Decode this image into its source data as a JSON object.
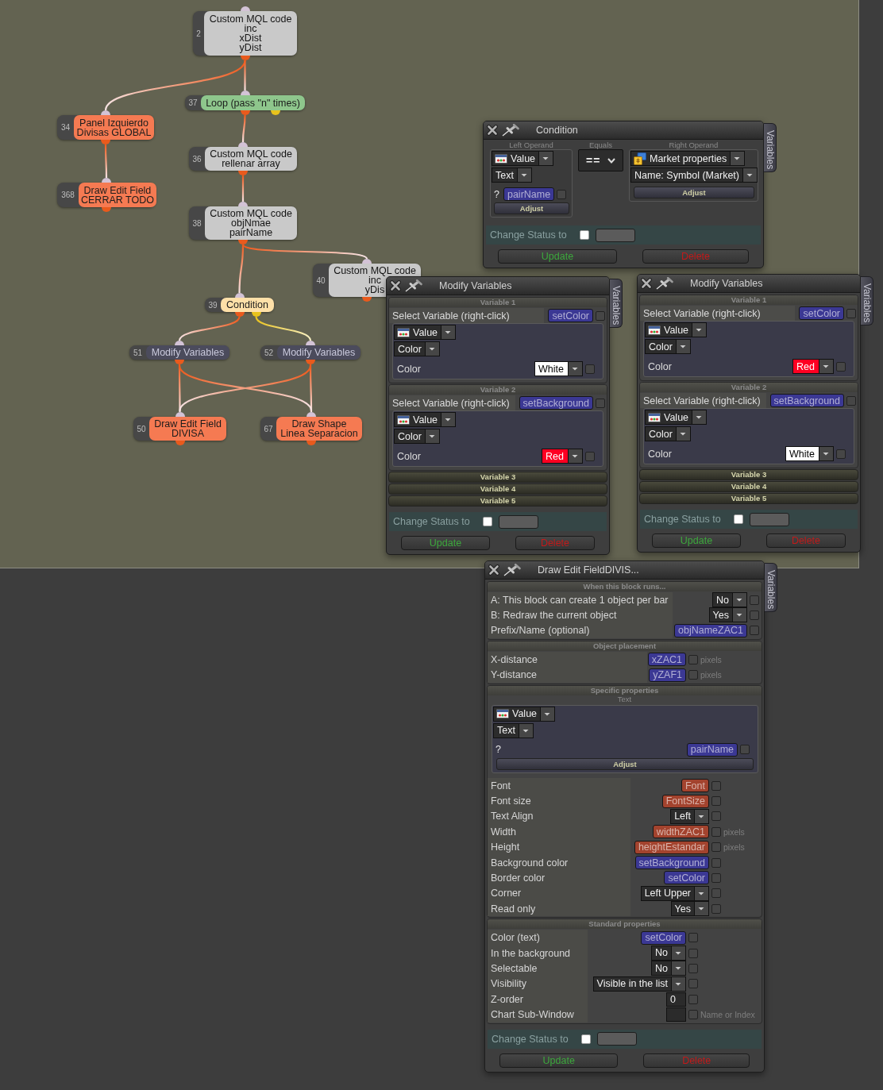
{
  "canvas": {
    "nodes": [
      {
        "number": "2",
        "kind": "code",
        "lines": [
          "Custom MQL code",
          "inc",
          "xDist",
          "yDist"
        ]
      },
      {
        "number": "37",
        "kind": "loop",
        "lines": [
          "Loop (pass \"n\" times)"
        ]
      },
      {
        "number": "34",
        "kind": "object",
        "lines": [
          "Panel Izquierdo",
          "Divisas GLOBAL"
        ]
      },
      {
        "number": "36",
        "kind": "code",
        "lines": [
          "Custom MQL code",
          "rellenar array"
        ]
      },
      {
        "number": "368",
        "kind": "object",
        "lines": [
          "Draw Edit Field",
          "CERRAR TODO"
        ]
      },
      {
        "number": "38",
        "kind": "code",
        "lines": [
          "Custom MQL code",
          "objNmae",
          "pairName"
        ]
      },
      {
        "number": "40",
        "kind": "code",
        "lines": [
          "Custom MQL code",
          "inc",
          "yDis"
        ]
      },
      {
        "number": "39",
        "kind": "condition",
        "lines": [
          "Condition"
        ]
      },
      {
        "number": "51",
        "kind": "modify",
        "lines": [
          "Modify Variables"
        ]
      },
      {
        "number": "52",
        "kind": "modify",
        "lines": [
          "Modify Variables"
        ]
      },
      {
        "number": "50",
        "kind": "object",
        "lines": [
          "Draw Edit Field",
          "DIVISA"
        ]
      },
      {
        "number": "67",
        "kind": "object",
        "lines": [
          "Draw Shape",
          "Linea Separacion"
        ]
      }
    ]
  },
  "windows": [
    {
      "kind": "condition",
      "title": "Condition",
      "side_tab": "Variables",
      "left_operand": {
        "heading": "Left Operand",
        "source": {
          "kind": "value",
          "label": "Value"
        },
        "type": "Text",
        "prefix": "?",
        "variable": {
          "label": "pairName",
          "color": "#3b3894"
        },
        "checked": false,
        "adjust": "Adjust"
      },
      "operator": {
        "heading": "Equals",
        "label": "=="
      },
      "right_operand": {
        "heading": "Right Operand",
        "source": {
          "kind": "market",
          "label": "Market properties"
        },
        "type": "Name: Symbol (Market)",
        "adjust": "Adjust"
      },
      "status": {
        "label": "Change Status to",
        "checked": false
      },
      "buttons": [
        {
          "kind": "update",
          "label": "Update"
        },
        {
          "kind": "delete",
          "label": "Delete"
        }
      ]
    },
    {
      "kind": "modify_variables",
      "title": "Modify Variables",
      "side_tab": "Variables",
      "variables": [
        {
          "heading": "Variable 1",
          "expanded": true,
          "select_label": "Select Variable (right-click)",
          "variable": {
            "label": "setColor",
            "color": "#3b3894"
          },
          "checked": false,
          "source": {
            "kind": "value",
            "label": "Value"
          },
          "type": "Color",
          "field_label": "Color",
          "value": {
            "label": "White",
            "color": "#ffffff"
          },
          "value_checked": false
        },
        {
          "heading": "Variable 2",
          "expanded": true,
          "select_label": "Select Variable (right-click)",
          "variable": {
            "label": "setBackground",
            "color": "#3b3894"
          },
          "checked": false,
          "source": {
            "kind": "value",
            "label": "Value"
          },
          "type": "Color",
          "field_label": "Color",
          "value": {
            "label": "Red",
            "color": "#ff0022"
          },
          "value_checked": false
        },
        {
          "heading": "Variable 3",
          "expanded": false
        },
        {
          "heading": "Variable 4",
          "expanded": false
        },
        {
          "heading": "Variable 5",
          "expanded": false
        }
      ],
      "status": {
        "label": "Change Status to",
        "checked": false
      },
      "buttons": [
        {
          "kind": "update",
          "label": "Update"
        },
        {
          "kind": "delete",
          "label": "Delete"
        }
      ]
    },
    {
      "kind": "modify_variables",
      "title": "Modify Variables",
      "side_tab": "Variables",
      "variables": [
        {
          "heading": "Variable 1",
          "expanded": true,
          "select_label": "Select Variable (right-click)",
          "variable": {
            "label": "setColor",
            "color": "#3b3894"
          },
          "checked": false,
          "source": {
            "kind": "value",
            "label": "Value"
          },
          "type": "Color",
          "field_label": "Color",
          "value": {
            "label": "Red",
            "color": "#ff0022"
          },
          "value_checked": false
        },
        {
          "heading": "Variable 2",
          "expanded": true,
          "select_label": "Select Variable (right-click)",
          "variable": {
            "label": "setBackground",
            "color": "#3b3894"
          },
          "checked": false,
          "source": {
            "kind": "value",
            "label": "Value"
          },
          "type": "Color",
          "field_label": "Color",
          "value": {
            "label": "White",
            "color": "#ffffff"
          },
          "value_checked": false
        },
        {
          "heading": "Variable 3",
          "expanded": false
        },
        {
          "heading": "Variable 4",
          "expanded": false
        },
        {
          "heading": "Variable 5",
          "expanded": false
        }
      ],
      "status": {
        "label": "Change Status to",
        "checked": false
      },
      "buttons": [
        {
          "kind": "update",
          "label": "Update"
        },
        {
          "kind": "delete",
          "label": "Delete"
        }
      ]
    },
    {
      "kind": "object_properties",
      "title": "Draw Edit FieldDIVIS...",
      "side_tab": "Variables",
      "sections": [
        {
          "heading": "When this block runs...",
          "rows": [
            {
              "label": "A: This block can create 1 object per bar",
              "value": {
                "kind": "dropdown",
                "label": "No"
              },
              "checked": false
            },
            {
              "label": "B: Redraw the current object",
              "value": {
                "kind": "dropdown",
                "label": "Yes"
              },
              "checked": false
            },
            {
              "label": "Prefix/Name (optional)",
              "value": {
                "kind": "chip",
                "label": "objNameZAC1",
                "color": "#3b3894"
              },
              "checked": false
            }
          ]
        },
        {
          "heading": "Object placement",
          "rows": [
            {
              "label": "X-distance",
              "value": {
                "kind": "chip",
                "label": "xZAC1",
                "color": "#3b3894"
              },
              "checked": false,
              "unit": "pixels"
            },
            {
              "label": "Y-distance",
              "value": {
                "kind": "chip",
                "label": "yZAF1",
                "color": "#3b3894"
              },
              "checked": false,
              "unit": "pixels"
            }
          ]
        },
        {
          "heading": "Specific properties",
          "subheading": "Text",
          "editor": {
            "source": {
              "kind": "value",
              "label": "Value"
            },
            "type": "Text",
            "prefix": "?",
            "variable": {
              "label": "pairName",
              "color": "#3b3894"
            },
            "checked": false,
            "adjust": "Adjust"
          },
          "rows": [
            {
              "label": "Font",
              "value": {
                "kind": "chip",
                "label": "Font",
                "color": "#a3432e"
              },
              "checked": false
            },
            {
              "label": "Font size",
              "value": {
                "kind": "chip",
                "label": "FontSize",
                "color": "#a3432e"
              },
              "checked": false
            },
            {
              "label": "Text Align",
              "value": {
                "kind": "dropdown",
                "label": "Left"
              },
              "checked": false
            },
            {
              "label": "Width",
              "value": {
                "kind": "chip",
                "label": "widthZAC1",
                "color": "#a3432e"
              },
              "checked": false,
              "unit": "pixels"
            },
            {
              "label": "Height",
              "value": {
                "kind": "chip",
                "label": "heightEstandar",
                "color": "#a3432e"
              },
              "checked": false,
              "unit": "pixels"
            },
            {
              "label": "Background color",
              "value": {
                "kind": "chip",
                "label": "setBackground",
                "color": "#3b3894"
              },
              "checked": false
            },
            {
              "label": "Border color",
              "value": {
                "kind": "chip",
                "label": "setColor",
                "color": "#3b3894"
              },
              "checked": false
            },
            {
              "label": "Corner",
              "value": {
                "kind": "dropdown",
                "label": "Left Upper"
              },
              "checked": false
            },
            {
              "label": "Read only",
              "value": {
                "kind": "dropdown",
                "label": "Yes"
              },
              "checked": false
            }
          ]
        },
        {
          "heading": "Standard properties",
          "rows": [
            {
              "label": "Color (text)",
              "value": {
                "kind": "chip",
                "label": "setColor",
                "color": "#3b3894"
              },
              "checked": false
            },
            {
              "label": "In the background",
              "value": {
                "kind": "dropdown",
                "label": "No"
              },
              "checked": false
            },
            {
              "label": "Selectable",
              "value": {
                "kind": "dropdown",
                "label": "No"
              },
              "checked": false
            },
            {
              "label": "Visibility",
              "value": {
                "kind": "dropdown",
                "label": "Visible in the list"
              },
              "checked": false
            },
            {
              "label": "Z-order",
              "value": {
                "kind": "number",
                "label": "0"
              },
              "checked": false
            },
            {
              "label": "Chart Sub-Window",
              "value": {
                "kind": "number"
              },
              "checked": false,
              "hint": "Name or Index"
            }
          ]
        }
      ],
      "status": {
        "label": "Change Status to",
        "checked": false
      },
      "buttons": [
        {
          "kind": "update",
          "label": "Update"
        },
        {
          "kind": "delete",
          "label": "Delete"
        }
      ]
    }
  ]
}
